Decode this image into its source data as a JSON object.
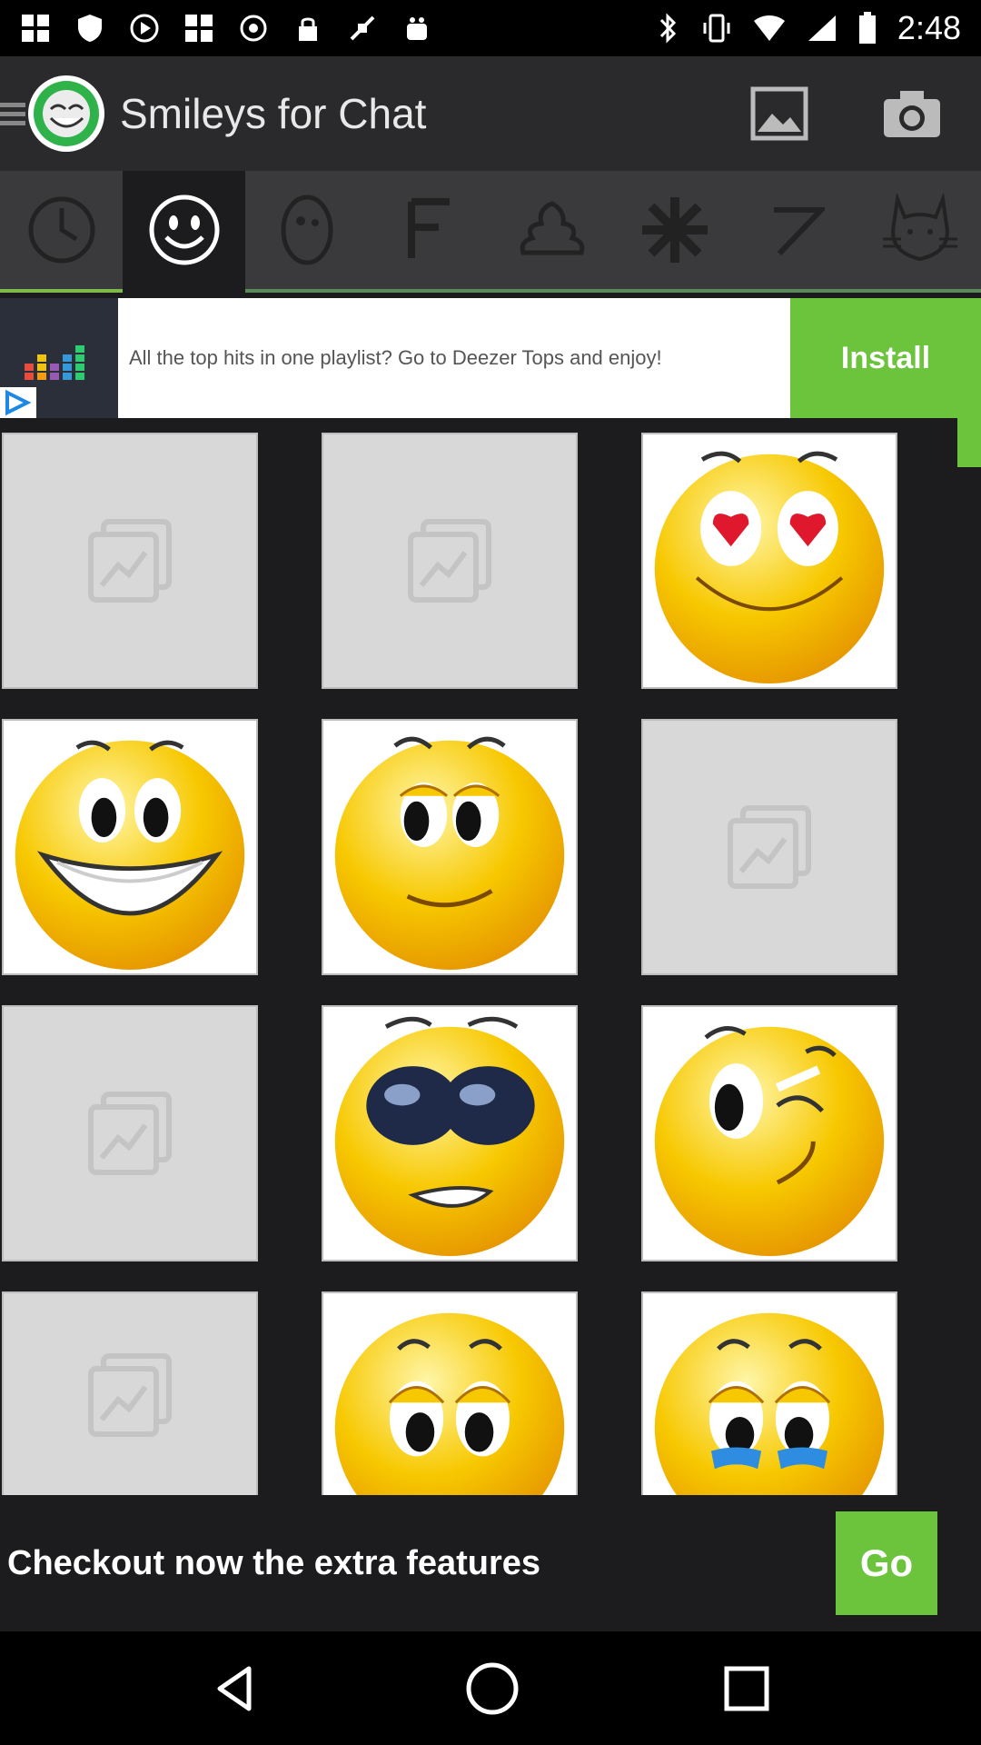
{
  "status_bar": {
    "time": "2:48"
  },
  "app_bar": {
    "title": "Smileys for Chat"
  },
  "tabs": [
    {
      "name": "recent",
      "icon": "clock-icon"
    },
    {
      "name": "smileys",
      "icon": "smiley-icon"
    },
    {
      "name": "faces",
      "icon": "face-icon"
    },
    {
      "name": "f-letter",
      "icon": "letter-f-icon"
    },
    {
      "name": "poop",
      "icon": "poop-icon"
    },
    {
      "name": "symbols",
      "icon": "asterisk-icon"
    },
    {
      "name": "z-letter",
      "icon": "letter-z-icon"
    },
    {
      "name": "animals",
      "icon": "cat-icon"
    }
  ],
  "ad": {
    "text": "All the top hits in one playlist? Go to Deezer Tops and enjoy!",
    "install_label": "Install"
  },
  "grid": {
    "cells": [
      {
        "type": "placeholder"
      },
      {
        "type": "placeholder"
      },
      {
        "type": "smiley",
        "face": "heart-eyes"
      },
      {
        "type": "smiley",
        "face": "big-grin"
      },
      {
        "type": "smiley",
        "face": "shy"
      },
      {
        "type": "placeholder"
      },
      {
        "type": "placeholder"
      },
      {
        "type": "smiley",
        "face": "sunglasses"
      },
      {
        "type": "smiley",
        "face": "wink"
      },
      {
        "type": "placeholder"
      },
      {
        "type": "smiley",
        "face": "sad"
      },
      {
        "type": "smiley",
        "face": "crying"
      }
    ]
  },
  "bottom_banner": {
    "text": "Checkout now the extra features",
    "go_label": "Go"
  },
  "colors": {
    "accent_green": "#6cc33c",
    "smiley_yellow": "#f7c800"
  }
}
